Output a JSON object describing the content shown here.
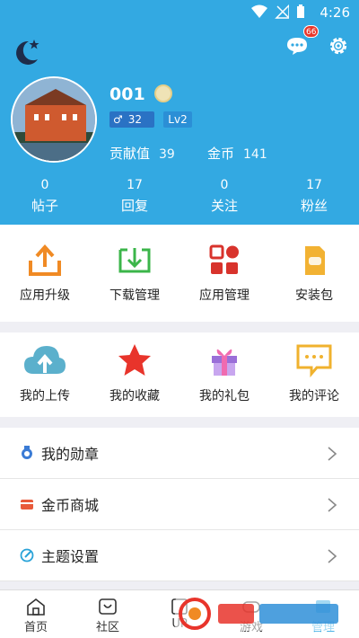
{
  "status_bar": {
    "time": "4:26"
  },
  "header": {
    "notification_count": "66",
    "username": "001",
    "gender_level": "32",
    "level": "Lv2",
    "contribution_label": "贡献值",
    "contribution_value": "39",
    "coins_label": "金币",
    "coins_value": "141"
  },
  "counts": [
    {
      "value": "0",
      "label": "帖子"
    },
    {
      "value": "17",
      "label": "回复"
    },
    {
      "value": "0",
      "label": "关注"
    },
    {
      "value": "17",
      "label": "粉丝"
    }
  ],
  "tools_row1": [
    {
      "label": "应用升级",
      "icon": "upload-tray-icon"
    },
    {
      "label": "下载管理",
      "icon": "download-tray-icon"
    },
    {
      "label": "应用管理",
      "icon": "apps-grid-icon"
    },
    {
      "label": "安装包",
      "icon": "apk-file-icon"
    }
  ],
  "tools_row2": [
    {
      "label": "我的上传",
      "icon": "cloud-upload-icon"
    },
    {
      "label": "我的收藏",
      "icon": "star-icon"
    },
    {
      "label": "我的礼包",
      "icon": "gift-icon"
    },
    {
      "label": "我的评论",
      "icon": "comment-icon"
    }
  ],
  "menu": [
    {
      "label": "我的勋章",
      "icon": "medal-icon"
    },
    {
      "label": "金币商城",
      "icon": "store-icon"
    },
    {
      "label": "主题设置",
      "icon": "palette-icon"
    }
  ],
  "bottom_nav": [
    {
      "label": "首页",
      "icon": "home-icon"
    },
    {
      "label": "社区",
      "icon": "community-icon"
    },
    {
      "label": "UP",
      "icon": "up-icon"
    },
    {
      "label": "游戏",
      "icon": "game-icon"
    },
    {
      "label": "管理",
      "icon": "manage-icon"
    }
  ],
  "colors": {
    "primary": "#33a9e2",
    "accent_orange": "#f08a24",
    "accent_green": "#3bb54a",
    "accent_red": "#d8332c",
    "background": "#efeff4"
  }
}
